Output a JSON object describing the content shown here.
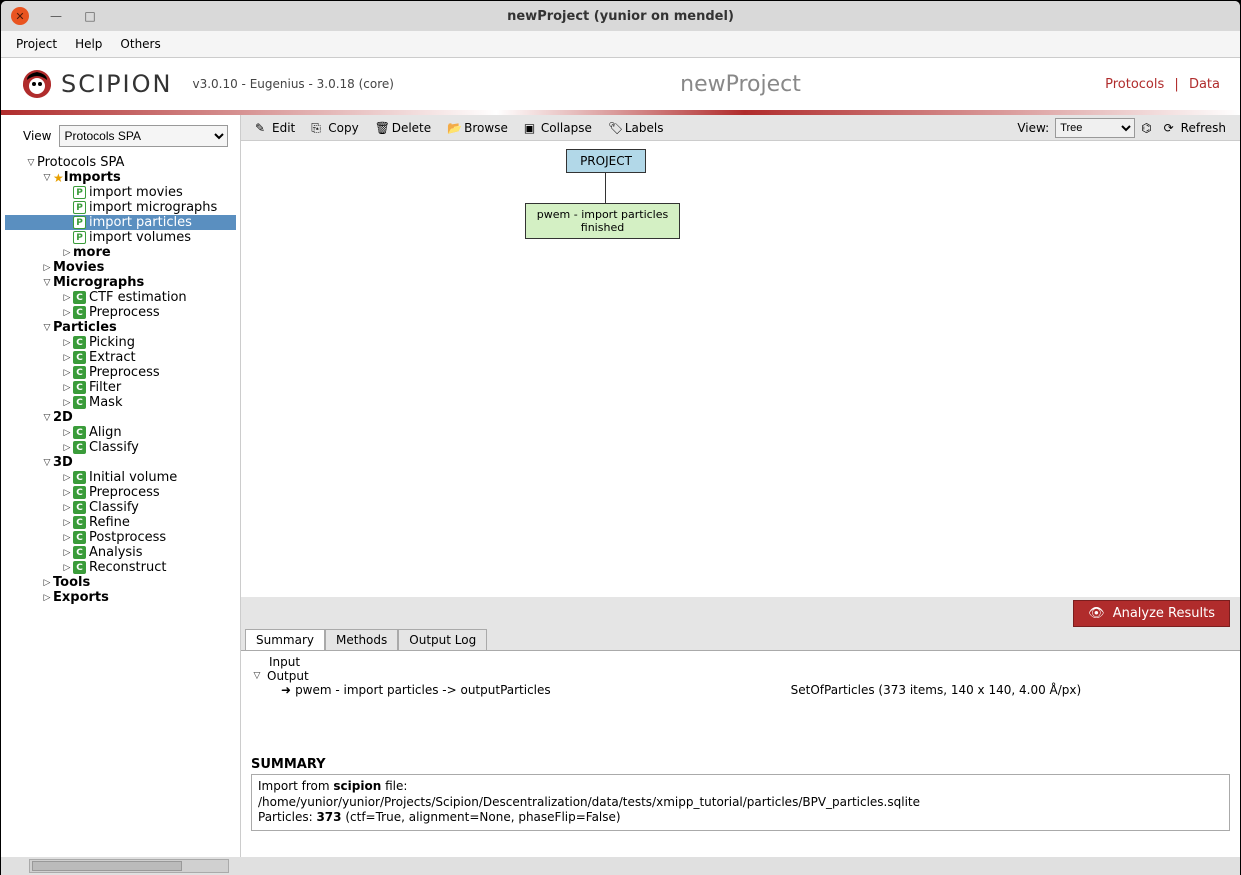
{
  "window": {
    "title": "newProject (yunior on mendel)"
  },
  "menubar": [
    "Project",
    "Help",
    "Others"
  ],
  "app": {
    "name": "SCIPION",
    "version": "v3.0.10 - Eugenius - 3.0.18 (core)",
    "project": "newProject"
  },
  "header_links": {
    "protocols": "Protocols",
    "data": "Data",
    "sep": "|"
  },
  "sidebar": {
    "view_label": "View",
    "view_value": "Protocols SPA",
    "root": "Protocols SPA",
    "imports": {
      "label": "Imports",
      "items": [
        "import movies",
        "import micrographs",
        "import particles",
        "import volumes"
      ],
      "more": "more"
    },
    "movies": "Movies",
    "micrographs": {
      "label": "Micrographs",
      "items": [
        "CTF estimation",
        "Preprocess"
      ]
    },
    "particles": {
      "label": "Particles",
      "items": [
        "Picking",
        "Extract",
        "Preprocess",
        "Filter",
        "Mask"
      ]
    },
    "d2": {
      "label": "2D",
      "items": [
        "Align",
        "Classify"
      ]
    },
    "d3": {
      "label": "3D",
      "items": [
        "Initial volume",
        "Preprocess",
        "Classify",
        "Refine",
        "Postprocess",
        "Analysis",
        "Reconstruct"
      ]
    },
    "tools": "Tools",
    "exports": "Exports"
  },
  "toolbar": {
    "edit": "Edit",
    "copy": "Copy",
    "delete": "Delete",
    "browse": "Browse",
    "collapse": "Collapse",
    "labels": "Labels",
    "view_label": "View:",
    "view_value": "Tree",
    "refresh": "Refresh"
  },
  "graph": {
    "project": "PROJECT",
    "node_title": "pwem - import particles",
    "node_status": "finished"
  },
  "analyze": "Analyze Results",
  "tabs": {
    "summary": "Summary",
    "methods": "Methods",
    "outputlog": "Output Log"
  },
  "io": {
    "input": "Input",
    "output": "Output",
    "output_item": "pwem - import particles -> outputParticles",
    "output_desc": "SetOfParticles (373 items, 140 x 140, 4.00 Å/px)"
  },
  "summary": {
    "header": "SUMMARY",
    "line1a": "Import from ",
    "line1b": "scipion",
    "line1c": " file:",
    "path": "/home/yunior/yunior/Projects/Scipion/Descentralization/data/tests/xmipp_tutorial/particles/BPV_particles.sqlite",
    "line3a": "Particles: ",
    "line3b": "373",
    "line3c": " (ctf=True, alignment=None, phaseFlip=False)"
  }
}
